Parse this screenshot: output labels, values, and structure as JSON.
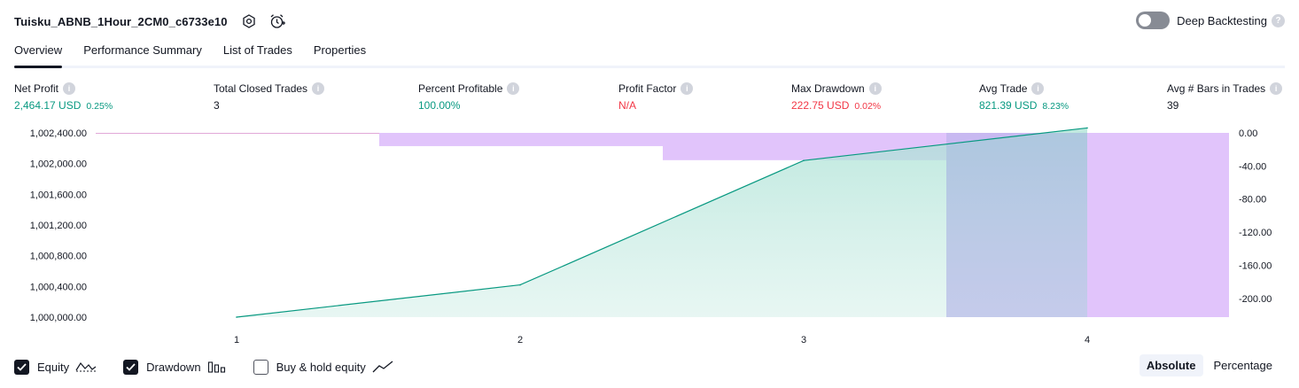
{
  "header": {
    "strategy_name": "Tuisku_ABNB_1Hour_2CM0_c6733e10",
    "icons": [
      "settings-icon",
      "add-alert-icon"
    ]
  },
  "deep_backtesting": {
    "label": "Deep Backtesting",
    "enabled": false,
    "help": "?"
  },
  "tabs": [
    {
      "label": "Overview",
      "active": true
    },
    {
      "label": "Performance Summary",
      "active": false
    },
    {
      "label": "List of Trades",
      "active": false
    },
    {
      "label": "Properties",
      "active": false
    }
  ],
  "metrics": {
    "net_profit": {
      "title": "Net Profit",
      "value": "2,464.17 USD",
      "sub": "0.25%"
    },
    "total_closed_trades": {
      "title": "Total Closed Trades",
      "value": "3"
    },
    "percent_profitable": {
      "title": "Percent Profitable",
      "value": "100.00%"
    },
    "profit_factor": {
      "title": "Profit Factor",
      "value": "N/A"
    },
    "max_drawdown": {
      "title": "Max Drawdown",
      "value": "222.75 USD",
      "sub": "0.02%"
    },
    "avg_trade": {
      "title": "Avg Trade",
      "value": "821.39 USD",
      "sub": "8.23%"
    },
    "avg_bars": {
      "title": "Avg # Bars in Trades",
      "value": "39"
    }
  },
  "chart_data": {
    "type": "area",
    "x": [
      1,
      2,
      3,
      4
    ],
    "x_tick_labels": [
      "1",
      "2",
      "3",
      "4"
    ],
    "left_axis": {
      "ticks": [
        "1,002,400.00",
        "1,002,000.00",
        "1,001,600.00",
        "1,001,200.00",
        "1,000,800.00",
        "1,000,400.00",
        "1,000,000.00"
      ],
      "range": [
        1000000,
        1002400
      ]
    },
    "right_axis": {
      "ticks": [
        "0.00",
        "-40.00",
        "-80.00",
        "-120.00",
        "-160.00",
        "-200.00"
      ],
      "range": [
        -222.75,
        0
      ]
    },
    "series": [
      {
        "name": "Equity",
        "values": [
          1000000,
          1000420,
          1002040,
          1002464.17
        ],
        "color": "#089981"
      }
    ],
    "drawdown_bars": [
      {
        "x": 1,
        "value": 0
      },
      {
        "x": 2,
        "value": -16
      },
      {
        "x": 3,
        "value": -33
      },
      {
        "x": 3.5,
        "value": -222.75
      },
      {
        "x": 4,
        "value": -222.75
      }
    ],
    "drawdown_color": "#e1c4fb",
    "grid": false
  },
  "legend": [
    {
      "label": "Equity",
      "checked": true,
      "icon": "equity-line-icon"
    },
    {
      "label": "Drawdown",
      "checked": true,
      "icon": "drawdown-bars-icon"
    },
    {
      "label": "Buy & hold equity",
      "checked": false,
      "icon": "buy-hold-line-icon"
    }
  ],
  "mode": {
    "absolute": "Absolute",
    "percentage": "Percentage",
    "selected": "Absolute"
  }
}
